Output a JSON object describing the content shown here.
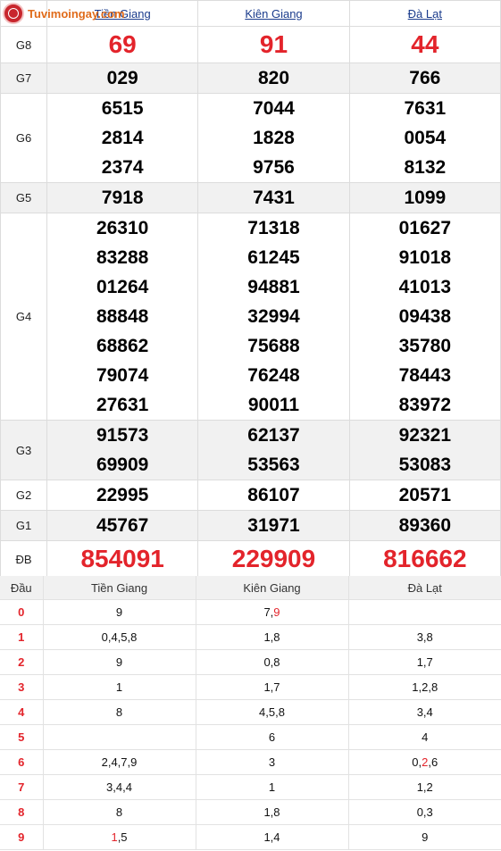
{
  "site": {
    "logo_text": "Tuvimoingay.com"
  },
  "provinces": [
    "Tiền Giang",
    "Kiên Giang",
    "Đà Lạt"
  ],
  "prizes": [
    {
      "label": "G8",
      "values": [
        [
          "69"
        ],
        [
          "91"
        ],
        [
          "44"
        ]
      ],
      "style": "red-large"
    },
    {
      "label": "G7",
      "values": [
        [
          "029"
        ],
        [
          "820"
        ],
        [
          "766"
        ]
      ]
    },
    {
      "label": "G6",
      "values": [
        [
          "6515",
          "2814",
          "2374"
        ],
        [
          "7044",
          "1828",
          "9756"
        ],
        [
          "7631",
          "0054",
          "8132"
        ]
      ]
    },
    {
      "label": "G5",
      "values": [
        [
          "7918"
        ],
        [
          "7431"
        ],
        [
          "1099"
        ]
      ]
    },
    {
      "label": "G4",
      "values": [
        [
          "26310",
          "83288",
          "01264",
          "88848",
          "68862",
          "79074",
          "27631"
        ],
        [
          "71318",
          "61245",
          "94881",
          "32994",
          "75688",
          "76248",
          "90011"
        ],
        [
          "01627",
          "91018",
          "41013",
          "09438",
          "35780",
          "78443",
          "83972"
        ]
      ]
    },
    {
      "label": "G3",
      "values": [
        [
          "91573",
          "69909"
        ],
        [
          "62137",
          "53563"
        ],
        [
          "92321",
          "53083"
        ]
      ]
    },
    {
      "label": "G2",
      "values": [
        [
          "22995"
        ],
        [
          "86107"
        ],
        [
          "20571"
        ]
      ]
    },
    {
      "label": "G1",
      "values": [
        [
          "45767"
        ],
        [
          "31971"
        ],
        [
          "89360"
        ]
      ]
    },
    {
      "label": "ĐB",
      "values": [
        [
          "854091"
        ],
        [
          "229909"
        ],
        [
          "816662"
        ]
      ],
      "style": "red-large"
    }
  ],
  "loto": {
    "head_label": "Đầu",
    "rows": [
      {
        "head": "0",
        "cells": [
          [
            {
              "t": "9"
            }
          ],
          [
            {
              "t": "7,"
            },
            {
              "t": "9",
              "red": true
            }
          ],
          []
        ]
      },
      {
        "head": "1",
        "cells": [
          [
            {
              "t": "0,4,5,8"
            }
          ],
          [
            {
              "t": "1,8"
            }
          ],
          [
            {
              "t": "3,8"
            }
          ]
        ]
      },
      {
        "head": "2",
        "cells": [
          [
            {
              "t": "9"
            }
          ],
          [
            {
              "t": "0,8"
            }
          ],
          [
            {
              "t": "1,7"
            }
          ]
        ]
      },
      {
        "head": "3",
        "cells": [
          [
            {
              "t": "1"
            }
          ],
          [
            {
              "t": "1,7"
            }
          ],
          [
            {
              "t": "1,2,8"
            }
          ]
        ]
      },
      {
        "head": "4",
        "cells": [
          [
            {
              "t": "8"
            }
          ],
          [
            {
              "t": "4,5,8"
            }
          ],
          [
            {
              "t": "3,4"
            }
          ]
        ]
      },
      {
        "head": "5",
        "cells": [
          [],
          [
            {
              "t": "6"
            }
          ],
          [
            {
              "t": "4"
            }
          ]
        ]
      },
      {
        "head": "6",
        "cells": [
          [
            {
              "t": "2,4,7,9"
            }
          ],
          [
            {
              "t": "3"
            }
          ],
          [
            {
              "t": "0,"
            },
            {
              "t": "2",
              "red": true
            },
            {
              "t": ",6"
            }
          ]
        ]
      },
      {
        "head": "7",
        "cells": [
          [
            {
              "t": "3,4,4"
            }
          ],
          [
            {
              "t": "1"
            }
          ],
          [
            {
              "t": "1,2"
            }
          ]
        ]
      },
      {
        "head": "8",
        "cells": [
          [
            {
              "t": "8"
            }
          ],
          [
            {
              "t": "1,8"
            }
          ],
          [
            {
              "t": "0,3"
            }
          ]
        ]
      },
      {
        "head": "9",
        "cells": [
          [
            {
              "t": "1",
              "red": true
            },
            {
              "t": ",5"
            }
          ],
          [
            {
              "t": "1,4"
            }
          ],
          [
            {
              "t": "9"
            }
          ]
        ]
      }
    ]
  },
  "colors": {
    "accent_red": "#e3242b",
    "link_blue": "#1a3b8c",
    "shade": "#f1f1f1"
  }
}
